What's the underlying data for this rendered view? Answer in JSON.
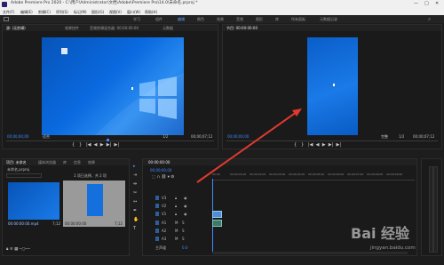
{
  "app": {
    "title": "Adobe Premiere Pro 2020 - C:\\用户\\Administrator\\文档\\Adobe\\Premiere Pro\\14.0\\未命名.prproj *",
    "window_controls": [
      "—",
      "□",
      "✕"
    ]
  },
  "menubar": {
    "items": [
      "文件(F)",
      "编辑(E)",
      "剪辑(C)",
      "序列(S)",
      "标记(M)",
      "图形(G)",
      "视图(V)",
      "窗口(W)",
      "帮助(H)"
    ]
  },
  "workspaces": {
    "items": [
      "学习",
      "组件",
      "编辑",
      "颜色",
      "效果",
      "音频",
      "图形",
      "库",
      "所有面板",
      "元数据记录"
    ],
    "active_index": 2
  },
  "source_monitor": {
    "tabs": [
      "源: (无剪辑)",
      "效果控件",
      "音频剪辑混合器: 00:00:00:00",
      "元数据"
    ],
    "timecode_left": "00;00;00;00",
    "fit_label": "适合",
    "fraction": "1/2",
    "timecode_right": "00;00;07;12"
  },
  "program_monitor": {
    "tab": "节目: 00:00:00:00",
    "timecode_left": "00;00;00;00",
    "fit_label": "完整",
    "fraction": "1/2",
    "timecode_right": "00;00;07;12"
  },
  "project": {
    "tabs": [
      "项目: 未命名",
      "媒体浏览器",
      "库",
      "信息",
      "效果"
    ],
    "name": "未命名.prproj",
    "item_count": "1 项已选择，共 2 项",
    "items": [
      {
        "name": "00:00:00:00.mp4",
        "duration": "7;12"
      },
      {
        "name": "00:00:00:00",
        "duration": "7;12"
      }
    ]
  },
  "timeline": {
    "tab": "00:00:00:00",
    "timecode": "00;00;00;00",
    "ruler": [
      "00;00",
      "00;00;01;00",
      "00;00;02;00",
      "00;00;03;00",
      "00;00;04;00",
      "00;00;05;00",
      "00;00;06;00",
      "00;00;07;00",
      "00;00;08;00",
      "00;00;09;00",
      "00;00;10;00"
    ],
    "video_tracks": [
      "V3",
      "V2",
      "V1"
    ],
    "audio_tracks": [
      "A1",
      "A2",
      "A3"
    ],
    "master_label": "主声道",
    "master_value": "0.0"
  },
  "watermark": {
    "text": "Bai 经验",
    "sub": "jingyan.baidu.com"
  },
  "colors": {
    "accent": "#3d8bff",
    "arrow": "#e03a2f",
    "desktop": "#0a62d6",
    "clip": "#4b8fd6"
  }
}
